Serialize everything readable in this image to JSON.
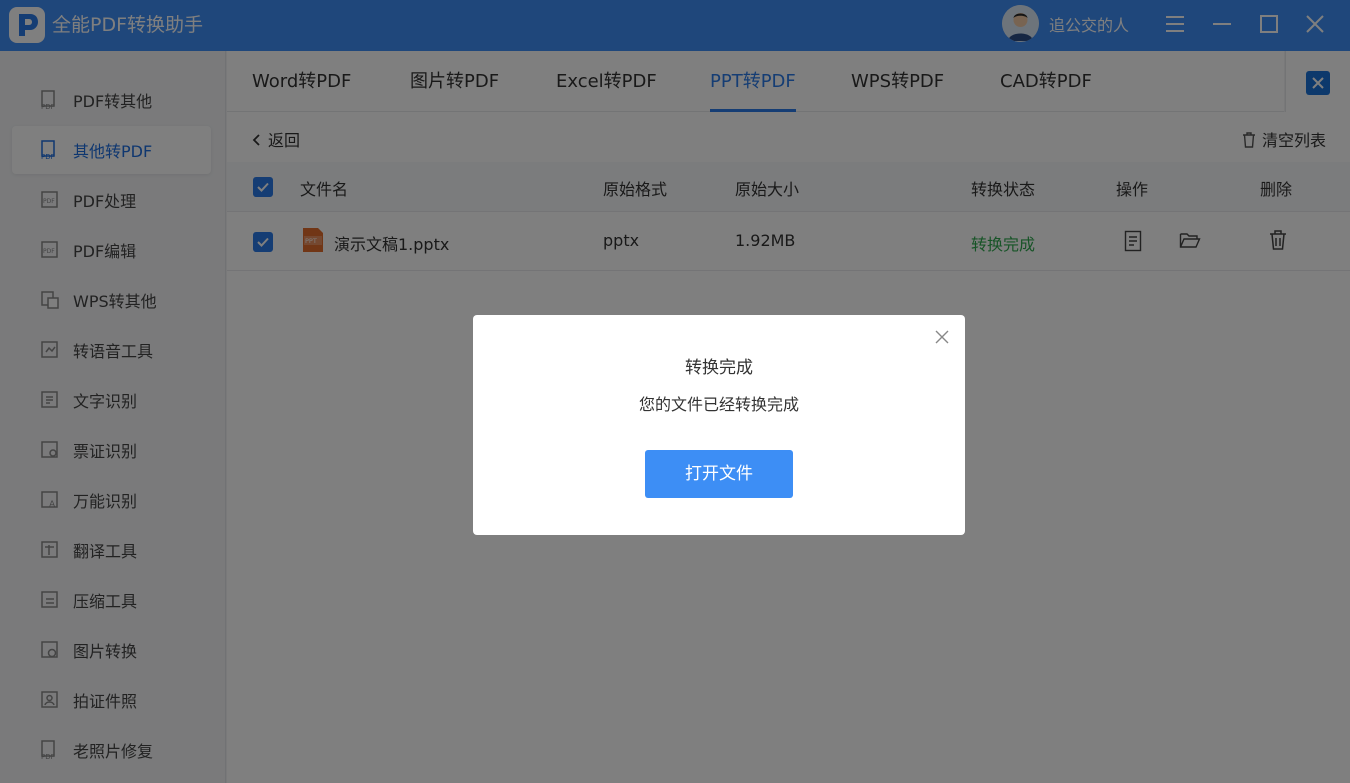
{
  "app": {
    "title": "全能PDF转换助手",
    "username": "追公交的人"
  },
  "sidebar": {
    "items": [
      {
        "label": "PDF转其他",
        "icon": "pdf-doc-icon"
      },
      {
        "label": "其他转PDF",
        "icon": "pdf-doc-icon"
      },
      {
        "label": "PDF处理",
        "icon": "pdf-doc-icon"
      },
      {
        "label": "PDF编辑",
        "icon": "pdf-doc-icon"
      },
      {
        "label": "WPS转其他",
        "icon": "wps-icon"
      },
      {
        "label": "转语音工具",
        "icon": "voice-icon"
      },
      {
        "label": "文字识别",
        "icon": "text-ocr-icon"
      },
      {
        "label": "票证识别",
        "icon": "ticket-icon"
      },
      {
        "label": "万能识别",
        "icon": "scan-icon"
      },
      {
        "label": "翻译工具",
        "icon": "translate-icon"
      },
      {
        "label": "压缩工具",
        "icon": "compress-icon"
      },
      {
        "label": "图片转换",
        "icon": "image-icon"
      },
      {
        "label": "拍证件照",
        "icon": "id-photo-icon"
      },
      {
        "label": "老照片修复",
        "icon": "photo-repair-icon"
      }
    ],
    "active_index": 1
  },
  "tabs": [
    {
      "label": "Word转PDF"
    },
    {
      "label": "图片转PDF"
    },
    {
      "label": "Excel转PDF"
    },
    {
      "label": "PPT转PDF"
    },
    {
      "label": "WPS转PDF"
    },
    {
      "label": "CAD转PDF"
    }
  ],
  "active_tab": 3,
  "toolbar": {
    "back_label": "返回",
    "clear_label": "清空列表"
  },
  "table": {
    "headers": {
      "name": "文件名",
      "format": "原始格式",
      "size": "原始大小",
      "status": "转换状态",
      "action": "操作",
      "delete": "删除"
    },
    "rows": [
      {
        "name": "演示文稿1.pptx",
        "format": "pptx",
        "size": "1.92MB",
        "status": "转换完成",
        "file_icon_label": "PPT"
      }
    ]
  },
  "dialog": {
    "title": "转换完成",
    "message": "您的文件已经转换完成",
    "button": "打开文件"
  },
  "colors": {
    "accent": "#2a7be8",
    "titlebar": "#3e8ef7",
    "success": "#2fa84f",
    "ppt": "#e36c2c"
  }
}
